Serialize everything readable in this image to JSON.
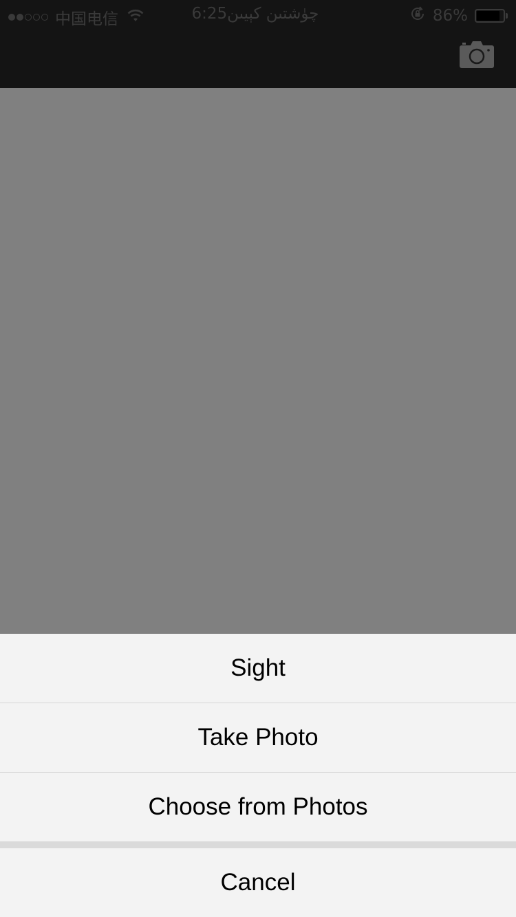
{
  "status_bar": {
    "carrier": "中国电信",
    "time_label": "چۈشتىن كېيىن",
    "time": "6:25",
    "battery_percent_text": "86%",
    "battery_level": 0.86,
    "signal_strength": 2,
    "signal_total": 5,
    "icons": [
      "wifi-icon",
      "rotation-lock-icon",
      "battery-icon"
    ]
  },
  "nav_bar": {
    "right_button_icon": "camera-icon"
  },
  "action_sheet": {
    "options": [
      {
        "label": "Sight"
      },
      {
        "label": "Take Photo"
      },
      {
        "label": "Choose from Photos"
      }
    ],
    "cancel_label": "Cancel"
  },
  "colors": {
    "bar_background": "#141414",
    "dim_overlay": "#808080",
    "sheet_background": "#f3f3f3",
    "divider": "#d6d6d6"
  }
}
